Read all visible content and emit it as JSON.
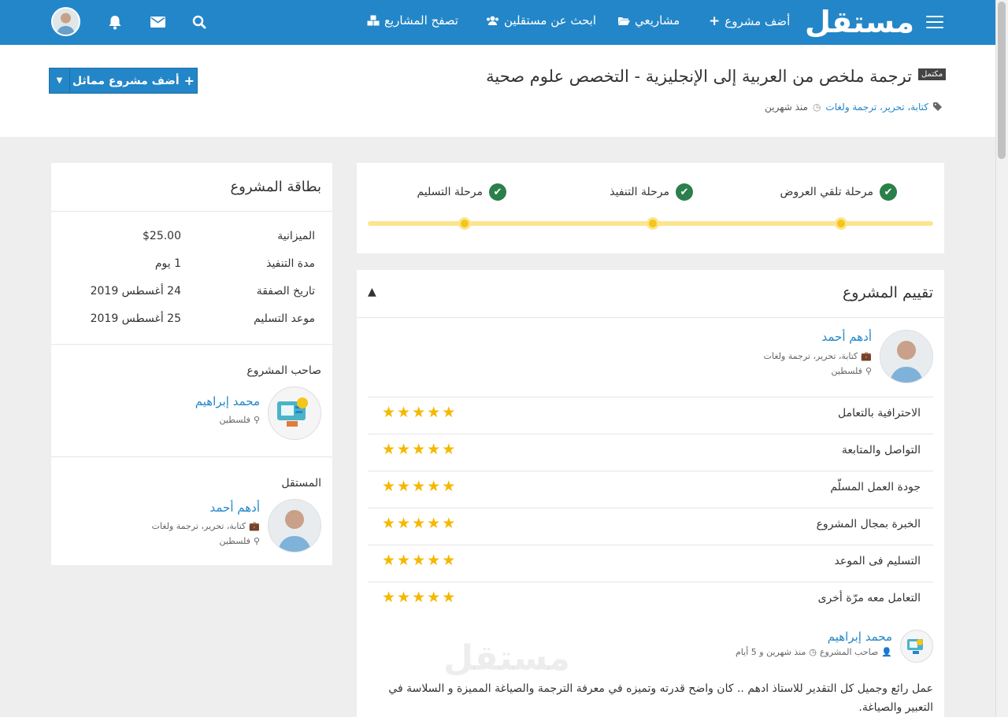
{
  "nav": {
    "logo": "مستقل",
    "add_project": "أضف مشروع",
    "my_projects": "مشاريعي",
    "find_freelancers": "ابحث عن مستقلين",
    "browse_projects": "تصفح المشاريع"
  },
  "header": {
    "status_badge": "مكتمل",
    "title": "ترجمة ملخص من العربية إلى الإنجليزية - التخصص علوم صحية",
    "tags": "كتابة، تحرير، ترجمة ولغات",
    "time": "منذ شهرين",
    "similar_button": "أضف مشروع مماثل"
  },
  "stages": [
    {
      "label": "مرحلة تلقي العروض"
    },
    {
      "label": "مرحلة التنفيذ"
    },
    {
      "label": "مرحلة التسليم"
    }
  ],
  "review": {
    "title": "تقييم المشروع",
    "freelancer": {
      "name": "أدهم أحمد",
      "skills": "كتابة، تحرير، ترجمة ولغات",
      "location": "فلسطين"
    },
    "ratings": [
      {
        "label": "الاحترافية بالتعامل",
        "stars": 5
      },
      {
        "label": "التواصل والمتابعة",
        "stars": 5
      },
      {
        "label": "جودة العمل المسلّم",
        "stars": 5
      },
      {
        "label": "الخبرة بمجال المشروع",
        "stars": 5
      },
      {
        "label": "التسليم فى الموعد",
        "stars": 5
      },
      {
        "label": "التعامل معه مرّة أخرى",
        "stars": 5
      }
    ],
    "comment": {
      "author": "محمد إبراهيم",
      "role": "صاحب المشروع",
      "time": "منذ شهرين و 5 أيام",
      "text": "عمل رائع وجميل كل التقدير للاستاذ ادهم .. كان واضح قدرته وتميزه في معرفة الترجمة والصياغة المميزة و السلاسة في التعبير والصياغة."
    },
    "watermark": "مستقل"
  },
  "project_card": {
    "title": "بطاقة المشروع",
    "rows": [
      {
        "key": "الميزانية",
        "value": "$25.00"
      },
      {
        "key": "مدة التنفيذ",
        "value": "1 يوم"
      },
      {
        "key": "تاريخ الصفقة",
        "value": "24 أغسطس 2019"
      },
      {
        "key": "موعد التسليم",
        "value": "25 أغسطس 2019"
      }
    ],
    "owner_label": "صاحب المشروع",
    "owner": {
      "name": "محمد إبراهيم",
      "location": "فلسطين"
    },
    "freelancer_label": "المستقل",
    "freelancer": {
      "name": "أدهم أحمد",
      "skills": "كتابة، تحرير، ترجمة ولغات",
      "location": "فلسطين"
    }
  }
}
